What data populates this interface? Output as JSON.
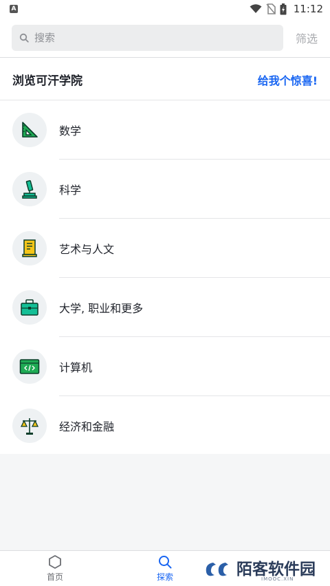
{
  "status_bar": {
    "app_icon_letter": "A",
    "time": "11:12"
  },
  "search": {
    "placeholder": "搜索",
    "filter_label": "筛选"
  },
  "header": {
    "title": "浏览可汗学院",
    "surprise_label": "给我个惊喜!"
  },
  "subjects": [
    {
      "label": "数学",
      "icon": "triangle-ruler-icon"
    },
    {
      "label": "科学",
      "icon": "microscope-icon"
    },
    {
      "label": "艺术与人文",
      "icon": "scroll-icon"
    },
    {
      "label": "大学, 职业和更多",
      "icon": "briefcase-icon"
    },
    {
      "label": "计算机",
      "icon": "code-window-icon"
    },
    {
      "label": "经济和金融",
      "icon": "balance-scale-icon"
    }
  ],
  "bottom_nav": {
    "items": [
      {
        "label": "首页",
        "icon": "hexagon-icon",
        "active": false
      },
      {
        "label": "探索",
        "icon": "search-icon",
        "active": true
      }
    ]
  },
  "watermark": {
    "text": "陌客软件园",
    "sub": "IMOOC.XIN"
  },
  "colors": {
    "accent": "#1865f2",
    "icon_green": "#1fab54",
    "icon_teal": "#14bf96",
    "icon_yellow": "#f5c518"
  }
}
